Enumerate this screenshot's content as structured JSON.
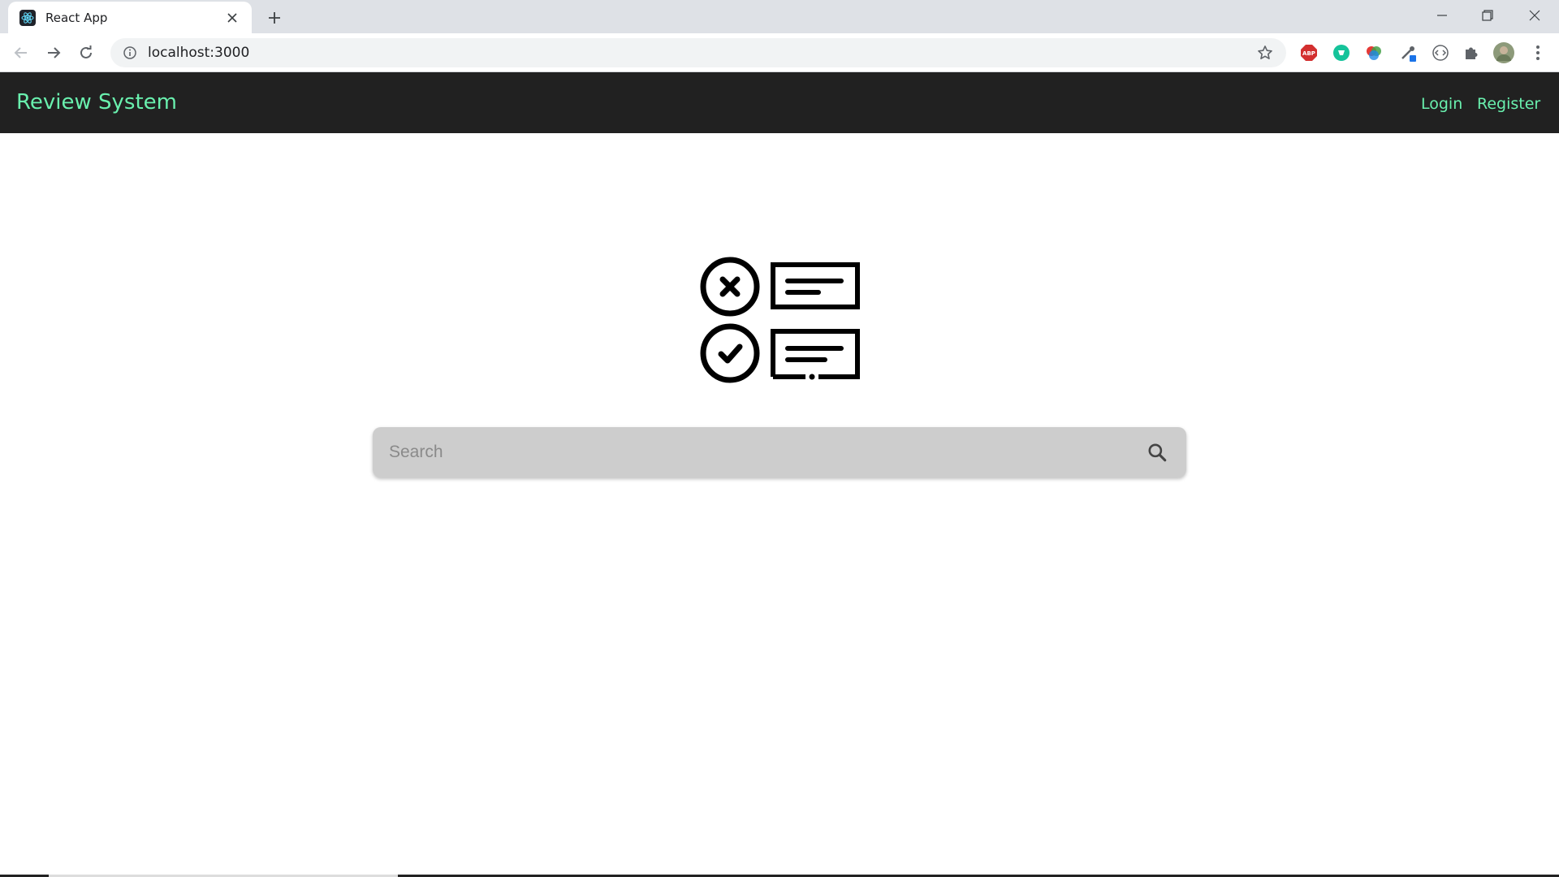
{
  "browser": {
    "tab_title": "React App",
    "url": "localhost:3000",
    "extension_icons": [
      "adblock-plus-icon",
      "grammarly-icon",
      "color-picker-icon",
      "eyedropper-icon",
      "code-icon",
      "extensions-puzzle-icon",
      "profile-avatar"
    ]
  },
  "navbar": {
    "brand": "Review System",
    "links": [
      "Login",
      "Register"
    ]
  },
  "search": {
    "placeholder": "Search"
  },
  "colors": {
    "accent": "#69f0ae",
    "navbar_bg": "#212121",
    "search_bg": "#cdcdcd"
  }
}
